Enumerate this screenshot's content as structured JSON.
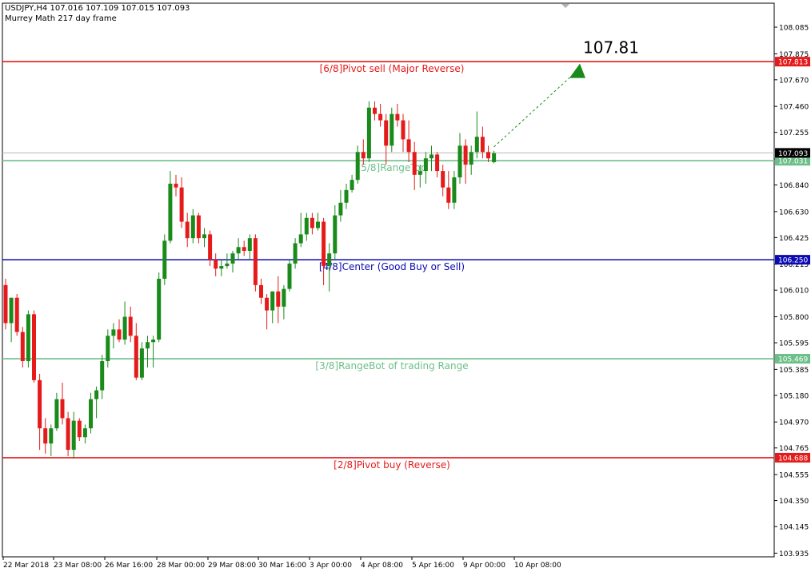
{
  "header": {
    "symbol_line": "USDJPY,H4  107.016 107.109 107.015 107.093",
    "indicator_line": "Murrey Math 217 day frame"
  },
  "colors": {
    "bull": "#1a8a1a",
    "bear": "#e51b1b",
    "pivot": "#e51b1b",
    "range": "#6dbf8a",
    "center": "#0b0bb3",
    "current": "#b8b8b8",
    "arrow": "#1a8a1a",
    "grid_axis": "#000000"
  },
  "chart_data": {
    "type": "candlestick",
    "symbol": "USDJPY",
    "timeframe": "H4",
    "ylim": [
      103.925,
      108.085
    ],
    "y_ticks": [
      "108.085",
      "107.875",
      "107.670",
      "107.460",
      "107.255",
      "107.045",
      "106.840",
      "106.630",
      "106.425",
      "106.215",
      "106.010",
      "105.800",
      "105.595",
      "105.385",
      "105.180",
      "104.970",
      "104.765",
      "104.555",
      "104.350",
      "104.145",
      "103.935"
    ],
    "x_labels": [
      "22 Mar 2018",
      "23 Mar 08:00",
      "26 Mar 16:00",
      "28 Mar 00:00",
      "29 Mar 08:00",
      "30 Mar 16:00",
      "3 Apr 00:00",
      "4 Apr 08:00",
      "5 Apr 16:00",
      "9 Apr 00:00",
      "10 Apr 08:00"
    ],
    "ohlc": [
      [
        106.05,
        106.1,
        105.7,
        105.75
      ],
      [
        105.75,
        105.95,
        105.6,
        105.95
      ],
      [
        105.95,
        105.98,
        105.65,
        105.68
      ],
      [
        105.68,
        105.72,
        105.4,
        105.45
      ],
      [
        105.45,
        105.85,
        105.4,
        105.82
      ],
      [
        105.82,
        105.85,
        105.28,
        105.3
      ],
      [
        105.3,
        105.35,
        104.75,
        104.92
      ],
      [
        104.92,
        105.0,
        104.72,
        104.8
      ],
      [
        104.8,
        104.95,
        104.7,
        104.92
      ],
      [
        104.92,
        105.2,
        104.9,
        105.15
      ],
      [
        105.15,
        105.28,
        104.95,
        105.0
      ],
      [
        105.0,
        105.05,
        104.7,
        104.75
      ],
      [
        104.75,
        105.05,
        104.68,
        104.98
      ],
      [
        104.98,
        105.0,
        104.82,
        104.85
      ],
      [
        104.85,
        104.95,
        104.8,
        104.92
      ],
      [
        104.92,
        105.2,
        104.88,
        105.15
      ],
      [
        105.15,
        105.25,
        105.0,
        105.22
      ],
      [
        105.22,
        105.5,
        105.15,
        105.45
      ],
      [
        105.45,
        105.7,
        105.4,
        105.65
      ],
      [
        105.65,
        105.75,
        105.55,
        105.7
      ],
      [
        105.7,
        105.78,
        105.6,
        105.62
      ],
      [
        105.62,
        105.92,
        105.58,
        105.8
      ],
      [
        105.8,
        105.88,
        105.6,
        105.65
      ],
      [
        105.65,
        105.75,
        105.3,
        105.32
      ],
      [
        105.32,
        105.6,
        105.3,
        105.55
      ],
      [
        105.55,
        105.65,
        105.4,
        105.6
      ],
      [
        105.6,
        105.65,
        105.4,
        105.62
      ],
      [
        105.62,
        106.15,
        105.6,
        106.1
      ],
      [
        106.1,
        106.45,
        106.05,
        106.4
      ],
      [
        106.4,
        106.95,
        106.38,
        106.85
      ],
      [
        106.85,
        106.92,
        106.75,
        106.82
      ],
      [
        106.82,
        106.9,
        106.5,
        106.55
      ],
      [
        106.55,
        106.62,
        106.35,
        106.42
      ],
      [
        106.42,
        106.65,
        106.38,
        106.6
      ],
      [
        106.6,
        106.62,
        106.38,
        106.42
      ],
      [
        106.42,
        106.5,
        106.35,
        106.45
      ],
      [
        106.45,
        106.48,
        106.2,
        106.25
      ],
      [
        106.25,
        106.3,
        106.12,
        106.18
      ],
      [
        106.18,
        106.25,
        106.12,
        106.2
      ],
      [
        106.2,
        106.3,
        106.18,
        106.22
      ],
      [
        106.22,
        106.32,
        106.15,
        106.3
      ],
      [
        106.3,
        106.42,
        106.25,
        106.35
      ],
      [
        106.35,
        106.4,
        106.28,
        106.32
      ],
      [
        106.32,
        106.45,
        106.25,
        106.42
      ],
      [
        106.42,
        106.45,
        106.0,
        106.05
      ],
      [
        106.05,
        106.1,
        105.9,
        105.95
      ],
      [
        105.95,
        105.98,
        105.7,
        105.85
      ],
      [
        105.85,
        106.0,
        105.75,
        106.0
      ],
      [
        106.0,
        106.12,
        105.75,
        105.88
      ],
      [
        105.88,
        106.05,
        105.78,
        106.02
      ],
      [
        106.02,
        106.25,
        106.0,
        106.22
      ],
      [
        106.22,
        106.42,
        106.18,
        106.38
      ],
      [
        106.38,
        106.62,
        106.35,
        106.45
      ],
      [
        106.45,
        106.62,
        106.4,
        106.58
      ],
      [
        106.58,
        106.62,
        106.45,
        106.5
      ],
      [
        106.5,
        106.62,
        106.48,
        106.55
      ],
      [
        106.55,
        106.58,
        106.05,
        106.2
      ],
      [
        106.2,
        106.38,
        106.0,
        106.3
      ],
      [
        106.3,
        106.68,
        106.25,
        106.6
      ],
      [
        106.6,
        106.8,
        106.55,
        106.7
      ],
      [
        106.7,
        106.85,
        106.65,
        106.8
      ],
      [
        106.8,
        106.92,
        106.78,
        106.88
      ],
      [
        106.88,
        107.15,
        106.85,
        107.1
      ],
      [
        107.1,
        107.2,
        107.0,
        107.05
      ],
      [
        107.05,
        107.5,
        107.02,
        107.45
      ],
      [
        107.45,
        107.5,
        107.35,
        107.4
      ],
      [
        107.4,
        107.48,
        107.3,
        107.35
      ],
      [
        107.35,
        107.4,
        107.0,
        107.15
      ],
      [
        107.15,
        107.45,
        107.1,
        107.4
      ],
      [
        107.4,
        107.48,
        107.3,
        107.35
      ],
      [
        107.35,
        107.4,
        107.1,
        107.2
      ],
      [
        107.2,
        107.35,
        107.02,
        107.1
      ],
      [
        107.1,
        107.18,
        106.8,
        106.92
      ],
      [
        106.92,
        107.0,
        106.82,
        106.95
      ],
      [
        106.95,
        107.1,
        106.85,
        107.05
      ],
      [
        107.05,
        107.15,
        106.95,
        107.08
      ],
      [
        107.08,
        107.1,
        106.9,
        106.95
      ],
      [
        106.95,
        107.0,
        106.75,
        106.82
      ],
      [
        106.82,
        106.95,
        106.65,
        106.7
      ],
      [
        106.7,
        106.95,
        106.65,
        106.9
      ],
      [
        106.9,
        107.25,
        106.85,
        107.15
      ],
      [
        107.15,
        107.2,
        106.85,
        107.0
      ],
      [
        107.0,
        107.15,
        106.92,
        107.1
      ],
      [
        107.1,
        107.42,
        107.05,
        107.22
      ],
      [
        107.22,
        107.3,
        107.05,
        107.1
      ],
      [
        107.1,
        107.15,
        107.02,
        107.05
      ],
      [
        107.02,
        107.11,
        107.01,
        107.09
      ]
    ],
    "levels": [
      {
        "price": 107.813,
        "label": "[6/8]Pivot sell (Major Reverse)",
        "tag": "107.813",
        "color_key": "pivot"
      },
      {
        "price": 107.031,
        "label": "[5/8]RangeTop",
        "tag": "107.031",
        "color_key": "range"
      },
      {
        "price": 106.25,
        "label": "[4/8]Center (Good Buy or Sell)",
        "tag": "106.250",
        "color_key": "center"
      },
      {
        "price": 105.469,
        "label": "[3/8]RangeBot of trading Range",
        "tag": "105.469",
        "color_key": "range"
      },
      {
        "price": 104.688,
        "label": "[2/8]Pivot buy (Reverse)",
        "tag": "104.688",
        "color_key": "pivot"
      }
    ],
    "current_price": {
      "price": 107.093,
      "tag": "107.093"
    },
    "target": {
      "price": 107.81,
      "label": "107.81"
    }
  }
}
